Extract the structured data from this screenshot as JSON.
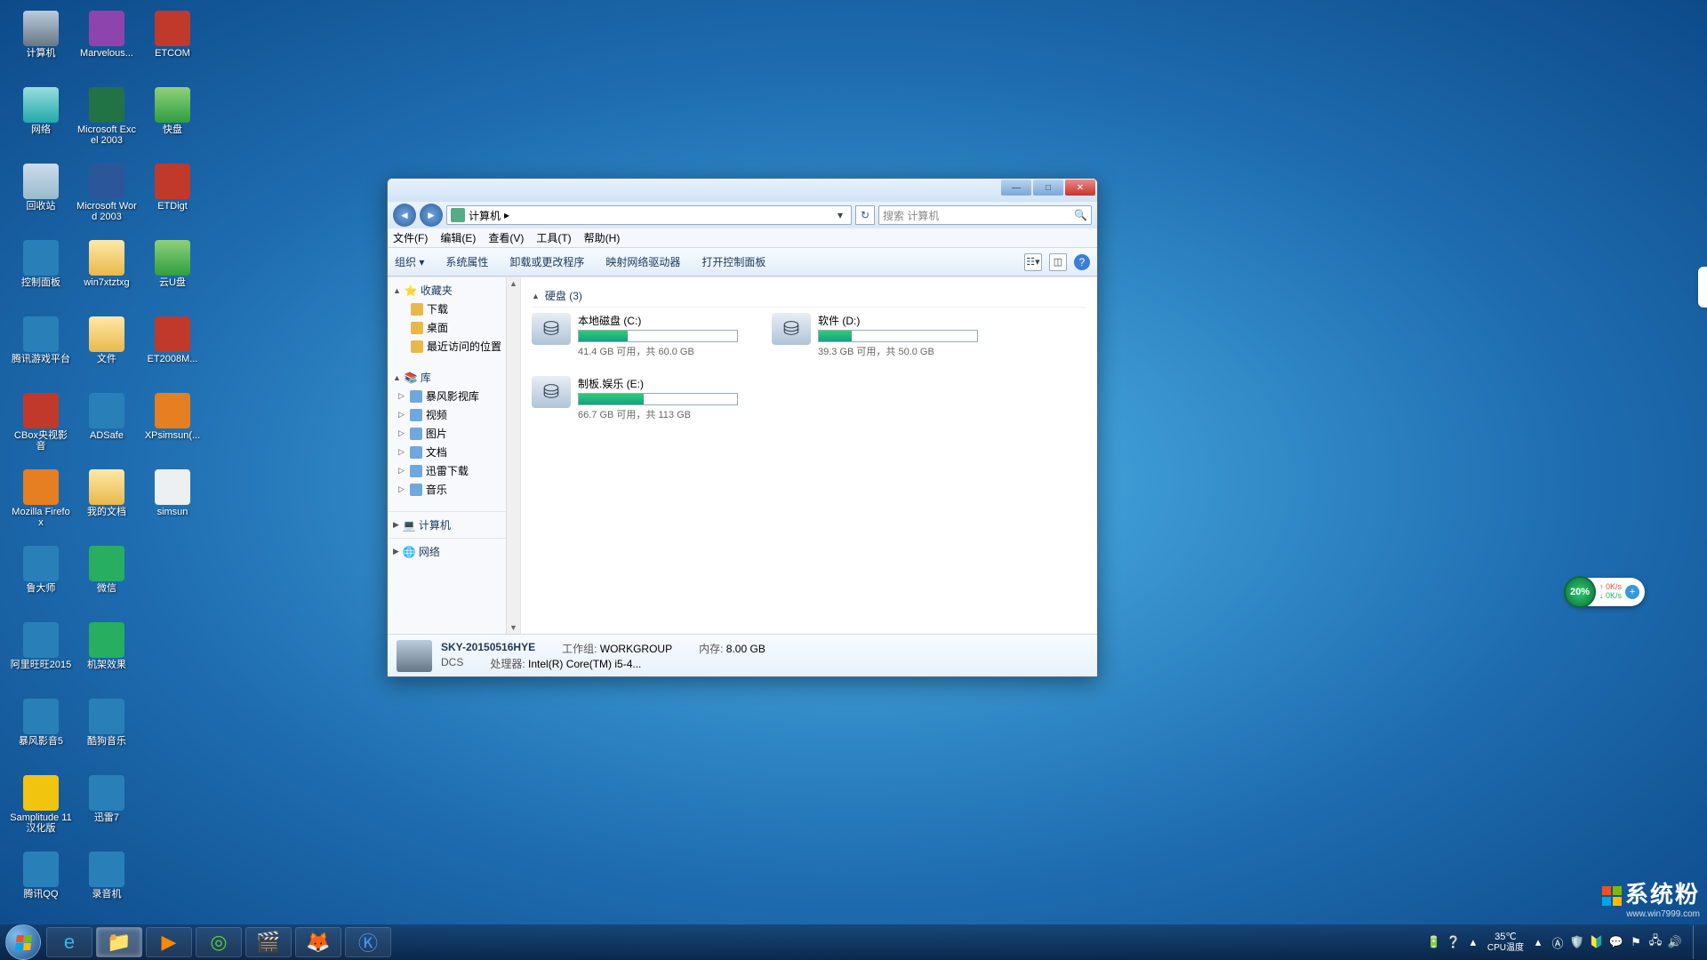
{
  "desktop_icons": [
    [
      {
        "n": "计算机",
        "c": "ic-computer"
      },
      {
        "n": "Marvelous...",
        "c": "ic-purple"
      },
      {
        "n": "ETCOM",
        "c": "ic-red"
      }
    ],
    [
      {
        "n": "网络",
        "c": "ic-net"
      },
      {
        "n": "Microsoft Excel 2003",
        "c": "ic-excel"
      },
      {
        "n": "快盘",
        "c": "ic-app"
      }
    ],
    [
      {
        "n": "回收站",
        "c": "ic-recycle"
      },
      {
        "n": "Microsoft Word 2003",
        "c": "ic-word"
      },
      {
        "n": "ETDigt",
        "c": "ic-red"
      }
    ],
    [
      {
        "n": "控制面板",
        "c": "ic-blue"
      },
      {
        "n": "win7xtztxg",
        "c": "ic-folder"
      },
      {
        "n": "云U盘",
        "c": "ic-app"
      }
    ],
    [
      {
        "n": "腾讯游戏平台",
        "c": "ic-blue"
      },
      {
        "n": "文件",
        "c": "ic-folder"
      },
      {
        "n": "ET2008M...",
        "c": "ic-red"
      }
    ],
    [
      {
        "n": "CBox央视影音",
        "c": "ic-red"
      },
      {
        "n": "ADSafe",
        "c": "ic-blue"
      },
      {
        "n": "XPsimsun(...",
        "c": "ic-orange"
      }
    ],
    [
      {
        "n": "Mozilla Firefox",
        "c": "ic-orange"
      },
      {
        "n": "我的文档",
        "c": "ic-folder"
      },
      {
        "n": "simsun",
        "c": "ic-white"
      }
    ],
    [
      {
        "n": "鲁大师",
        "c": "ic-blue"
      },
      {
        "n": "微信",
        "c": "ic-green"
      },
      {
        "n": "",
        "c": ""
      }
    ],
    [
      {
        "n": "阿里旺旺2015",
        "c": "ic-blue"
      },
      {
        "n": "机架效果",
        "c": "ic-green"
      },
      {
        "n": "",
        "c": ""
      }
    ],
    [
      {
        "n": "暴风影音5",
        "c": "ic-blue"
      },
      {
        "n": "酷狗音乐",
        "c": "ic-blue"
      },
      {
        "n": "",
        "c": ""
      }
    ],
    [
      {
        "n": "Samplitude 11 汉化版",
        "c": "ic-yellow"
      },
      {
        "n": "迅雷7",
        "c": "ic-blue"
      },
      {
        "n": "",
        "c": ""
      }
    ],
    [
      {
        "n": "腾讯QQ",
        "c": "ic-blue"
      },
      {
        "n": "录音机",
        "c": "ic-blue"
      },
      {
        "n": "",
        "c": ""
      }
    ]
  ],
  "window": {
    "breadcrumb_root": "计算机",
    "breadcrumb_sep": "▸",
    "search_placeholder": "搜索 计算机",
    "menu": [
      "文件(F)",
      "编辑(E)",
      "查看(V)",
      "工具(T)",
      "帮助(H)"
    ],
    "toolbar_left": [
      "组织 ▾",
      "系统属性",
      "卸载或更改程序",
      "映射网络驱动器",
      "打开控制面板"
    ],
    "section_title": "硬盘 (3)",
    "drives": [
      {
        "name": "本地磁盘 (C:)",
        "text": "41.4 GB 可用，共 60.0 GB",
        "fill": 31
      },
      {
        "name": "软件 (D:)",
        "text": "39.3 GB 可用，共 50.0 GB",
        "fill": 21
      },
      {
        "name": "制板.娱乐 (E:)",
        "text": "66.7 GB 可用，共 113 GB",
        "fill": 41
      }
    ],
    "nav": {
      "fav_hdr": "收藏夹",
      "fav_items": [
        "下载",
        "桌面",
        "最近访问的位置"
      ],
      "lib_hdr": "库",
      "lib_items": [
        "暴风影视库",
        "视频",
        "图片",
        "文档",
        "迅雷下载",
        "音乐"
      ],
      "computer_hdr": "计算机",
      "network_hdr": "网络"
    },
    "details": {
      "name": "SKY-20150516HYE",
      "sub": "DCS",
      "wg_label": "工作组:",
      "wg": "WORKGROUP",
      "cpu_label": "处理器:",
      "cpu": "Intel(R) Core(TM) i5-4...",
      "mem_label": "内存:",
      "mem": "8.00 GB"
    }
  },
  "gadget": {
    "pct": "20%",
    "up": "0K/s",
    "down": "0K/s"
  },
  "watermark": {
    "brand": "系统粉",
    "url": "www.win7999.com"
  },
  "tray": {
    "temp": "35℃",
    "temp_label": "CPU温度"
  }
}
